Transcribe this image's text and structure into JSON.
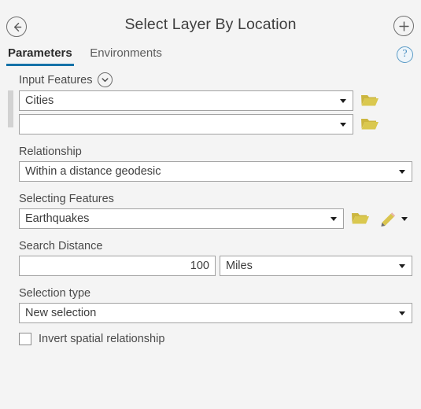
{
  "window": {
    "title": "Select Layer By Location",
    "back_icon": "back-arrow-icon",
    "add_icon": "plus-icon",
    "help_icon": "question-mark-icon",
    "help_glyph": "?"
  },
  "tabs": [
    {
      "label": "Parameters",
      "active": true
    },
    {
      "label": "Environments",
      "active": false
    }
  ],
  "accent_color": "#1572a8",
  "parameters": {
    "input_features": {
      "label": "Input Features",
      "expander_icon": "chevron-down-icon",
      "rows": [
        {
          "value": "Cities",
          "browse_icon": "folder-icon"
        },
        {
          "value": "",
          "browse_icon": "folder-icon"
        }
      ]
    },
    "relationship": {
      "label": "Relationship",
      "value": "Within a distance geodesic"
    },
    "selecting_features": {
      "label": "Selecting Features",
      "value": "Earthquakes",
      "browse_icon": "folder-icon",
      "draw_icon": "pencil-icon"
    },
    "search_distance": {
      "label": "Search Distance",
      "value": "100",
      "unit": "Miles"
    },
    "selection_type": {
      "label": "Selection type",
      "value": "New selection"
    },
    "invert": {
      "label": "Invert spatial relationship",
      "checked": false
    }
  }
}
